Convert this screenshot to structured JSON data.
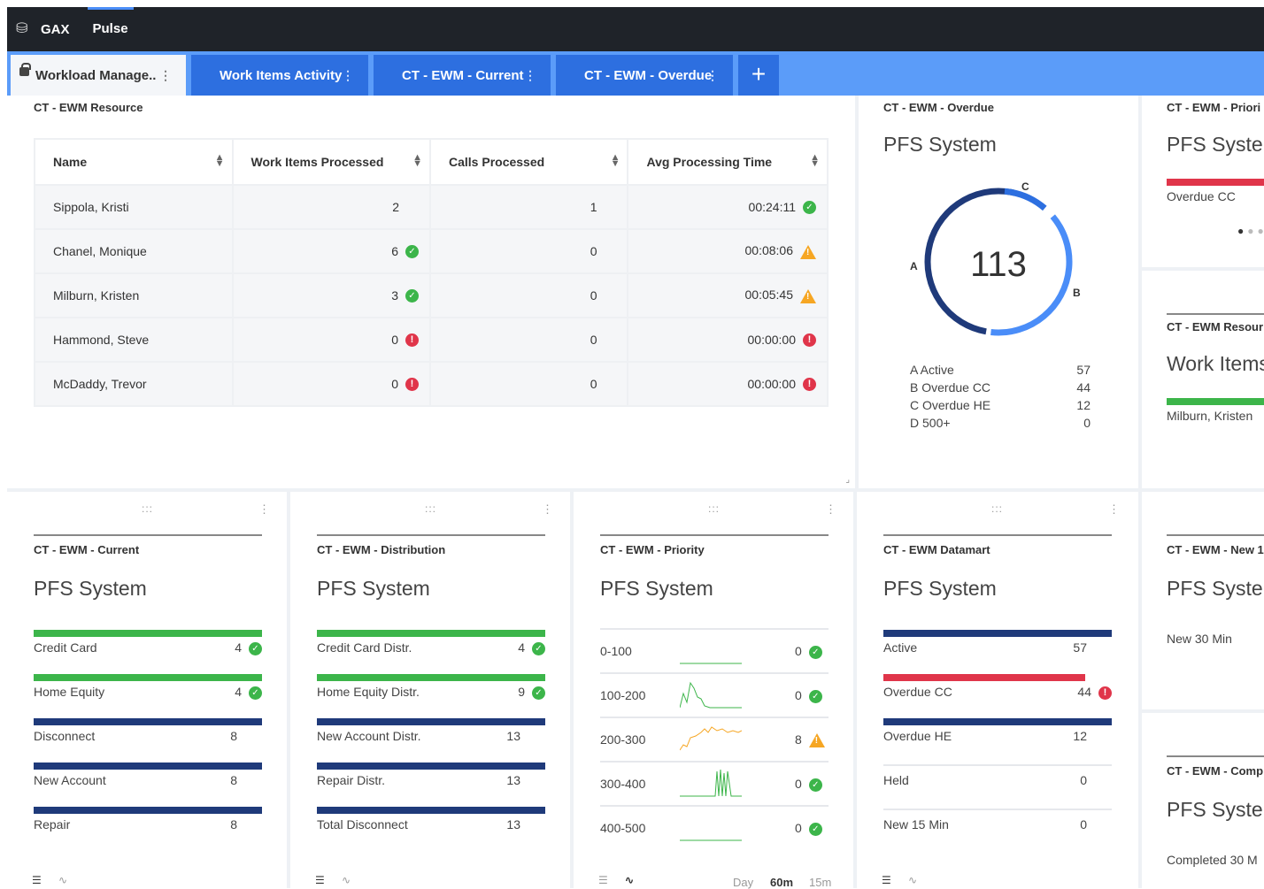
{
  "app": {
    "name": "GAX",
    "section": "Pulse"
  },
  "tabs": [
    "Workload Manage..",
    "Work Items Activity",
    "CT - EWM - Current",
    "CT - EWM - Overdue"
  ],
  "resource": {
    "title": "CT - EWM Resource",
    "headers": [
      "Name",
      "Work Items Processed",
      "Calls Processed",
      "Avg Processing Time"
    ],
    "rows": [
      {
        "name": "Sippola, Kristi",
        "items": "2",
        "calls": "1",
        "avg": "00:24:11"
      },
      {
        "name": "Chanel, Monique",
        "items": "6",
        "calls": "0",
        "avg": "00:08:06"
      },
      {
        "name": "Milburn, Kristen",
        "items": "3",
        "calls": "0",
        "avg": "00:05:45"
      },
      {
        "name": "Hammond, Steve",
        "items": "0",
        "calls": "0",
        "avg": "00:00:00"
      },
      {
        "name": "McDaddy, Trevor",
        "items": "0",
        "calls": "0",
        "avg": "00:00:00"
      }
    ]
  },
  "overdue": {
    "title": "CT - EWM - Overdue",
    "system": "PFS System",
    "total": "113",
    "labels": {
      "a": "A",
      "b": "B",
      "c": "C"
    },
    "legend": [
      {
        "k": "A Active",
        "v": "57"
      },
      {
        "k": "B Overdue CC",
        "v": "44"
      },
      {
        "k": "C Overdue HE",
        "v": "12"
      },
      {
        "k": "D 500+",
        "v": "0"
      }
    ]
  },
  "priority_right": {
    "title": "CT - EWM - Priori",
    "system": "PFS Syster",
    "item": "Overdue CC"
  },
  "resource_right": {
    "title": "CT - EWM Resour",
    "system": "Work Items",
    "item": "Milburn, Kristen"
  },
  "current": {
    "title": "CT - EWM - Current",
    "system": "PFS System",
    "items": [
      {
        "k": "Credit Card",
        "v": "4"
      },
      {
        "k": "Home Equity",
        "v": "4"
      },
      {
        "k": "Disconnect",
        "v": "8"
      },
      {
        "k": "New Account",
        "v": "8"
      },
      {
        "k": "Repair",
        "v": "8"
      }
    ]
  },
  "distribution": {
    "title": "CT - EWM - Distribution",
    "system": "PFS System",
    "items": [
      {
        "k": "Credit Card Distr.",
        "v": "4"
      },
      {
        "k": "Home Equity Distr.",
        "v": "9"
      },
      {
        "k": "New Account Distr.",
        "v": "13"
      },
      {
        "k": "Repair Distr.",
        "v": "13"
      },
      {
        "k": "Total Disconnect",
        "v": "13"
      }
    ]
  },
  "priority": {
    "title": "CT - EWM - Priority",
    "system": "PFS System",
    "items": [
      {
        "k": "0-100",
        "v": "0"
      },
      {
        "k": "100-200",
        "v": "0"
      },
      {
        "k": "200-300",
        "v": "8"
      },
      {
        "k": "300-400",
        "v": "0"
      },
      {
        "k": "400-500",
        "v": "0"
      }
    ],
    "timeframes": [
      "Day",
      "60m",
      "15m"
    ]
  },
  "datamart": {
    "title": "CT - EWM Datamart",
    "system": "PFS System",
    "items": [
      {
        "k": "Active",
        "v": "57"
      },
      {
        "k": "Overdue CC",
        "v": "44"
      },
      {
        "k": "Overdue HE",
        "v": "12"
      },
      {
        "k": "Held",
        "v": "0"
      },
      {
        "k": "New 15 Min",
        "v": "0"
      }
    ]
  },
  "new_right": {
    "title": "CT - EWM - New 1",
    "system": "PFS Syster",
    "item": "New 30 Min"
  },
  "comp_right": {
    "title": "CT - EWM - Comp",
    "system": "PFS Syster",
    "item": "Completed 30 M"
  },
  "colors": {
    "green": "#3cb54a",
    "navy": "#1f3a7a",
    "red": "#e0354a",
    "blue": "#2d6fe0"
  }
}
